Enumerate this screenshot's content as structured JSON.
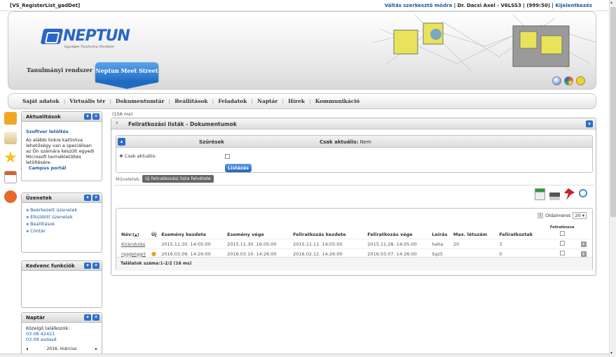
{
  "topbar": {
    "app_id": "[VS_RegisterList_gadDet]",
    "switch_mode": "Váltás szerkesztő módra",
    "user": "Dr. Dacsi Axel - V6LSS3",
    "session": "(999:50)",
    "logout": "Kijelentkezés"
  },
  "header": {
    "logo_text": "NEPTUN",
    "logo_sub": "Egységes Tanulmányi Rendszer",
    "tab_study": "Tanulmányi rendszer",
    "tab_meet": "Neptun Meet Street"
  },
  "menu": [
    "Saját adatok",
    "Virtuális tér",
    "Dokumentumtár",
    "Beállítások",
    "Feladatok",
    "Naptár",
    "Hírek",
    "Kommunikáció"
  ],
  "panels": {
    "news": {
      "title": "Aktualitások",
      "link": "Szoftver letöltés",
      "text": "Az alábbi linkre kattintva lehetőségy van a speciálisan az Ön számára készült egyedi Microsoft termékletöltés letöltésére.",
      "link2": "Campus portál"
    },
    "messages": {
      "title": "Üzenetek",
      "items": [
        "Beérkezett üzenetek",
        "Elküldött üzenetek",
        "Beállítások",
        "Címtár"
      ]
    },
    "favorites": {
      "title": "Kedvenc funkciók"
    },
    "calendar": {
      "title": "Naptár",
      "upcoming": "Közelgő találkozók:",
      "items": [
        "03.08 42421",
        "03.09 asdasd"
      ],
      "month": "2016. március"
    }
  },
  "main": {
    "ms": "(156 ms)",
    "title": "Feliratkozási listák - Dokumentumok",
    "filter_title": "Szűrések",
    "filter_current_label": "Csak aktuális:",
    "filter_current_value": "Nem",
    "filter_row_label": "Csak aktuális:",
    "list_button": "Listázás",
    "operations_label": "Műveletek:",
    "new_button": "Új feliratkozási lista felvétele",
    "page_size_label": "Oldalméret",
    "page_size": "20",
    "page_num": "1",
    "columns": [
      "Név:",
      "Új",
      "Esemény kezdete",
      "Esemény vége",
      "Feliratkozás kezdete",
      "Feliratkozás vége",
      "Leírás",
      "Max. létszám",
      "Feliratkoztak",
      "Feliratkozva"
    ],
    "sort_mark": "[▲]",
    "rows": [
      {
        "name": "Kirándulás",
        "new": "",
        "ev_start": "2015.11.30. 14:05:00",
        "ev_end": "2015.11.30. 16:05:00",
        "reg_start": "2015.11.11. 14:05:00",
        "reg_end": "2015.11.28. 14:05:00",
        "desc": "haha",
        "max": "20",
        "count": "3"
      },
      {
        "name": "rgggetggrt",
        "new": "●",
        "ev_start": "2016.03.09. 14:26:00",
        "ev_end": "2016.03.10. 14:26:00",
        "reg_start": "2016.02.12. 14:26:00",
        "reg_end": "2016.03.07. 14:26:00",
        "desc": "Sqz5",
        "max": "",
        "count": "0"
      }
    ],
    "footer": "Találatok száma:1-2/2 (16 ms)"
  }
}
